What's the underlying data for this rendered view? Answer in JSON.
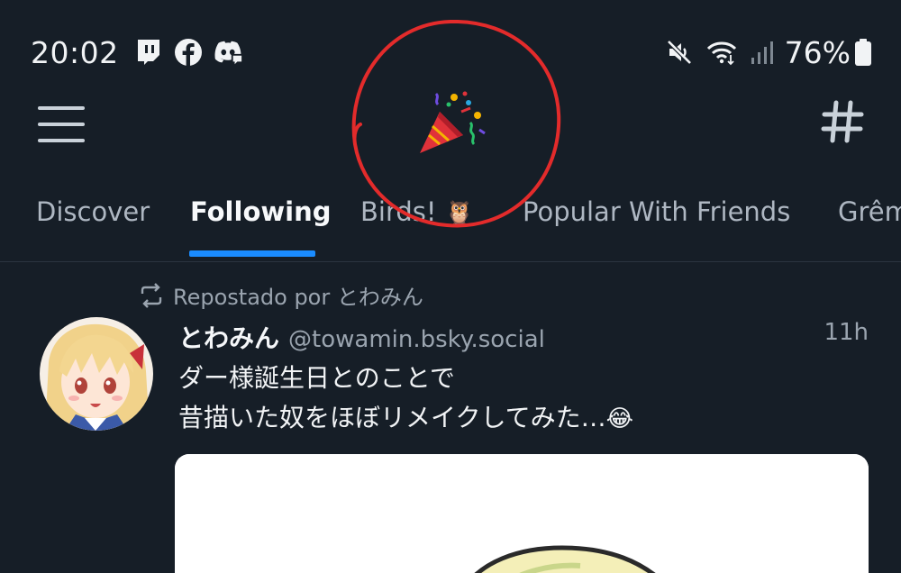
{
  "status_bar": {
    "time": "20:02",
    "battery_percent": "76%",
    "app_icons": [
      "twitch-icon",
      "facebook-icon",
      "discord-icon"
    ],
    "system_icons": [
      "mute-icon",
      "wifi-icon",
      "signal-icon",
      "battery-icon"
    ]
  },
  "header": {
    "menu_icon": "hamburger-menu-icon",
    "logo": "party-popper-emoji",
    "feeds_icon": "hashtag-icon"
  },
  "tabs": [
    {
      "label": "Discover"
    },
    {
      "label": "Following"
    },
    {
      "label": "Birds! "
    },
    {
      "label": "Popular With Friends"
    },
    {
      "label": "Grêm"
    }
  ],
  "active_tab": "Following",
  "post": {
    "repost_label": "Repostado por とわみん",
    "author_name": "とわみん",
    "author_handle": "@towamin.bsky.social",
    "time": "11h",
    "text_line1": "ダー様誕生日とのことで",
    "text_line2": "昔描いた奴をほぼリメイクしてみた…"
  },
  "colors": {
    "background": "#161e27",
    "accent": "#1a8cff",
    "annotation": "#e32b2b"
  }
}
